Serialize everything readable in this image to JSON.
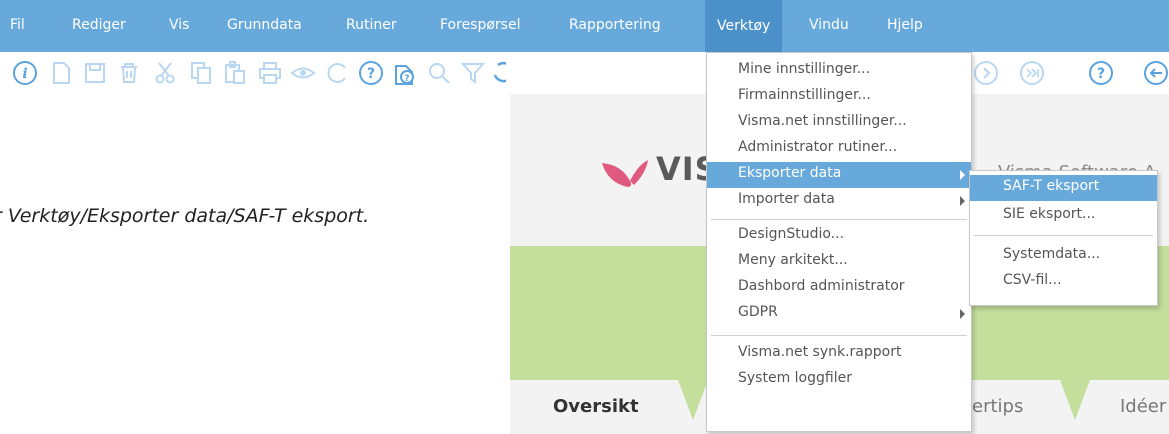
{
  "menubar": {
    "items": [
      "Fil",
      "Rediger",
      "Vis",
      "Grunndata",
      "Rutiner",
      "Forespørsel",
      "Rapportering",
      "Verktøy",
      "Vindu",
      "Hjelp"
    ],
    "active": "Verktøy"
  },
  "toolbar": {
    "icons": [
      "info-icon",
      "new-document-icon",
      "save-icon",
      "delete-icon",
      "cut-icon",
      "copy-icon",
      "paste-icon",
      "print-icon",
      "preview-icon",
      "refresh-icon",
      "help-icon",
      "context-help-icon",
      "search-icon",
      "filter-icon",
      "undo-icon",
      "next-icon",
      "last-icon",
      "help-circle-icon",
      "back-icon"
    ]
  },
  "main": {
    "caption": "r Verktøy/Eksporter data/SAF-T eksport.",
    "logo_text": "VIS",
    "company_text": "Visma Software A",
    "tabs": [
      "Oversikt",
      "ertips",
      "Idéer"
    ]
  },
  "verktoy_menu": {
    "items": [
      {
        "label": "Mine innstillinger...",
        "submenu": false
      },
      {
        "label": "Firmainnstillinger...",
        "submenu": false
      },
      {
        "label": "Visma.net innstillinger...",
        "submenu": false
      },
      {
        "label": "Administrator rutiner...",
        "submenu": false
      },
      {
        "label": "Eksporter data",
        "submenu": true,
        "highlighted": true
      },
      {
        "label": "Importer data",
        "submenu": true
      },
      {
        "label": "DesignStudio...",
        "submenu": false
      },
      {
        "label": "Meny arkitekt...",
        "submenu": false
      },
      {
        "label": "Dashbord administrator",
        "submenu": false
      },
      {
        "label": "GDPR",
        "submenu": true
      },
      {
        "label": "Visma.net synk.rapport",
        "submenu": false
      },
      {
        "label": "System loggfiler",
        "submenu": false
      }
    ]
  },
  "eksporter_submenu": {
    "items": [
      {
        "label": "SAF-T eksport",
        "highlighted": true
      },
      {
        "label": "SIE eksport..."
      },
      {
        "label": "Systemdata..."
      },
      {
        "label": "CSV-fil..."
      }
    ]
  },
  "colors": {
    "menubar": "#68a9dc",
    "highlight": "#68a9dc",
    "green_band": "#c3df9b",
    "logo_pink": "#e05a80",
    "icon": "#7fb6e3"
  }
}
